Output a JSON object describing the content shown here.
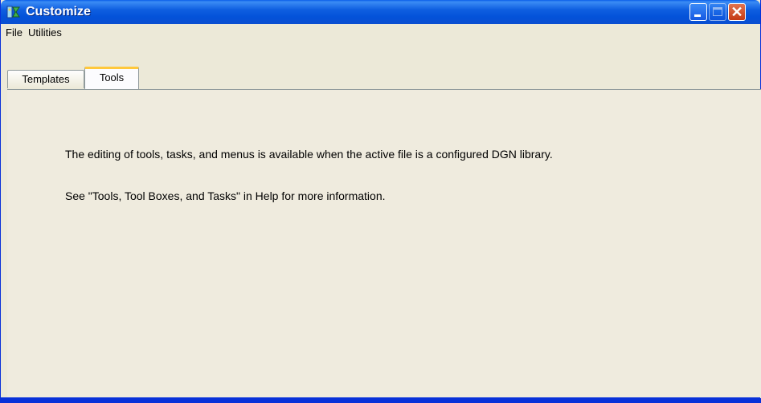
{
  "window": {
    "title": "Customize",
    "icon": "customize-app-icon",
    "controls": {
      "minimize_icon": "minimize-icon",
      "maximize_icon": "maximize-icon",
      "close_glyph": "✕"
    }
  },
  "menubar": {
    "items": [
      {
        "label": "File"
      },
      {
        "label": "Utilities"
      }
    ]
  },
  "tabs": [
    {
      "label": "Templates",
      "active": false
    },
    {
      "label": "Tools",
      "active": true
    }
  ],
  "panel": {
    "lines": [
      "The editing of tools, tasks, and menus is available when the active file is a configured DGN library.",
      "See \"Tools, Tool Boxes, and Tasks\" in Help for more information."
    ]
  },
  "colors": {
    "titlebar": "#0a5fe8",
    "tab_highlight": "#ffc83c",
    "face": "#ece9d8",
    "close_button": "#c43a15"
  }
}
